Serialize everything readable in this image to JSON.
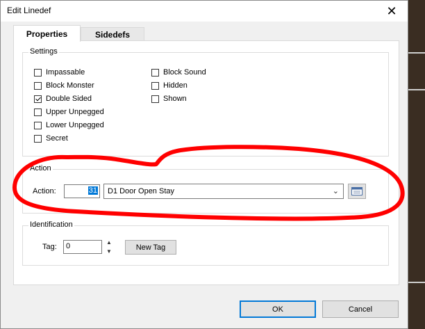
{
  "window": {
    "title": "Edit Linedef",
    "close_glyph": "✕"
  },
  "tabs": [
    {
      "label": "Properties",
      "active": true
    },
    {
      "label": "Sidedefs",
      "active": false
    }
  ],
  "settings": {
    "title": "Settings",
    "left_checks": [
      {
        "label": "Impassable",
        "checked": false
      },
      {
        "label": "Block Monster",
        "checked": false
      },
      {
        "label": "Double Sided",
        "checked": true
      },
      {
        "label": "Upper Unpegged",
        "checked": false
      },
      {
        "label": "Lower Unpegged",
        "checked": false
      },
      {
        "label": "Secret",
        "checked": false
      }
    ],
    "right_checks": [
      {
        "label": "Block Sound",
        "checked": false
      },
      {
        "label": "Hidden",
        "checked": false
      },
      {
        "label": "Shown",
        "checked": false
      }
    ]
  },
  "action": {
    "title": "Action",
    "label": "Action:",
    "number": "31",
    "selected": "D1 Door Open Stay",
    "browse_icon": "list-browser-icon"
  },
  "identification": {
    "title": "Identification",
    "tag_label": "Tag:",
    "tag_value": "0",
    "new_tag_label": "New Tag"
  },
  "buttons": {
    "ok": "OK",
    "cancel": "Cancel"
  },
  "colors": {
    "annotation": "#ff0000",
    "accent": "#0078d7"
  }
}
